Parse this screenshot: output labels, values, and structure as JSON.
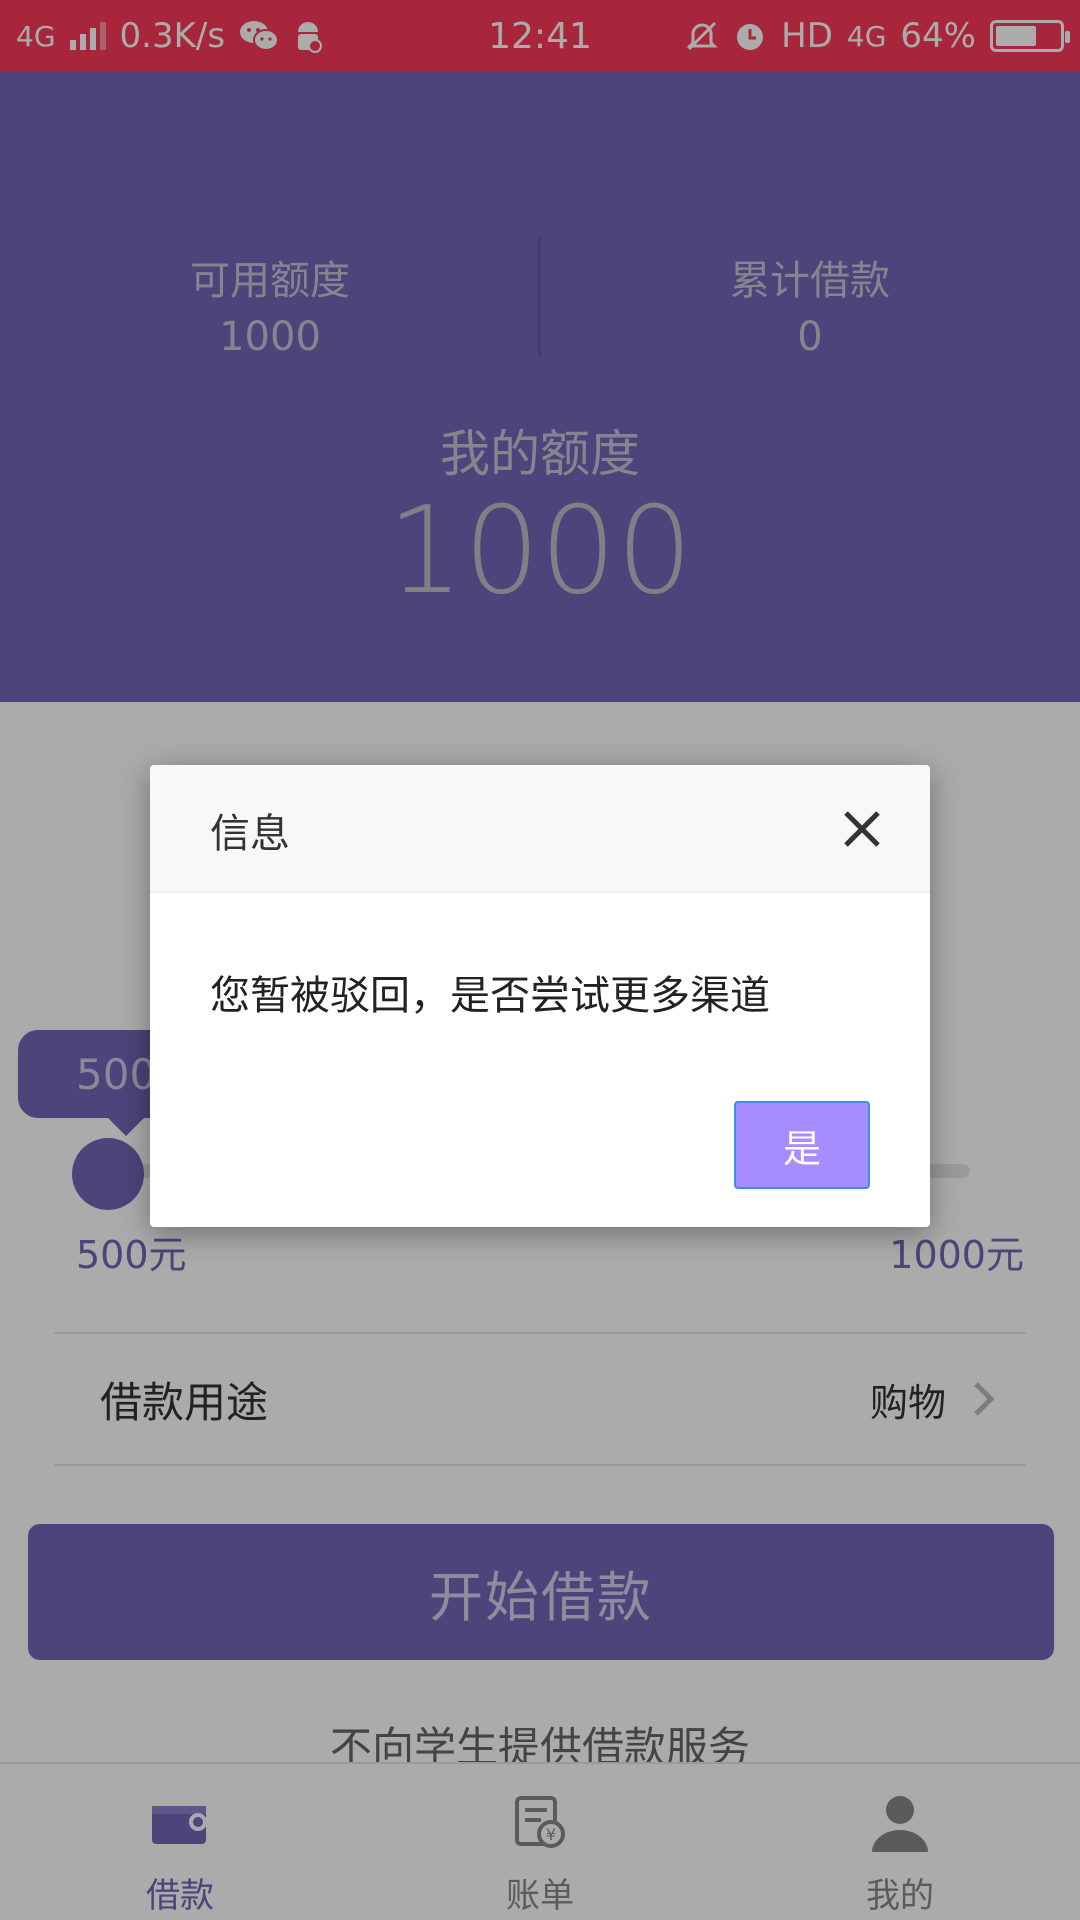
{
  "status_bar": {
    "network": "4G",
    "speed": "0.3K/s",
    "time": "12:41",
    "hd": "HD",
    "net_right": "4G",
    "battery": "64%",
    "battery_level": 0.64
  },
  "header": {
    "available_label": "可用额度",
    "available_value": "1000",
    "total_label": "累计借款",
    "total_value": "0",
    "quota_label": "我的额度",
    "quota_value": "1000"
  },
  "slider": {
    "bubble": "500",
    "min_label": "500元",
    "max_label": "1000元"
  },
  "purpose": {
    "label": "借款用途",
    "value": "购物"
  },
  "start_button": "开始借款",
  "notice": "不向学生提供借款服务",
  "tabs": [
    {
      "label": "借款",
      "icon": "wallet-icon",
      "active": true
    },
    {
      "label": "账单",
      "icon": "bill-icon",
      "active": false
    },
    {
      "label": "我的",
      "icon": "user-icon",
      "active": false
    }
  ],
  "dialog": {
    "title": "信息",
    "message": "您暂被驳回，是否尝试更多渠道",
    "yes": "是"
  },
  "colors": {
    "status": "#f93a5a",
    "primary": "#7565b6",
    "dialog_button": "#a68dff"
  }
}
